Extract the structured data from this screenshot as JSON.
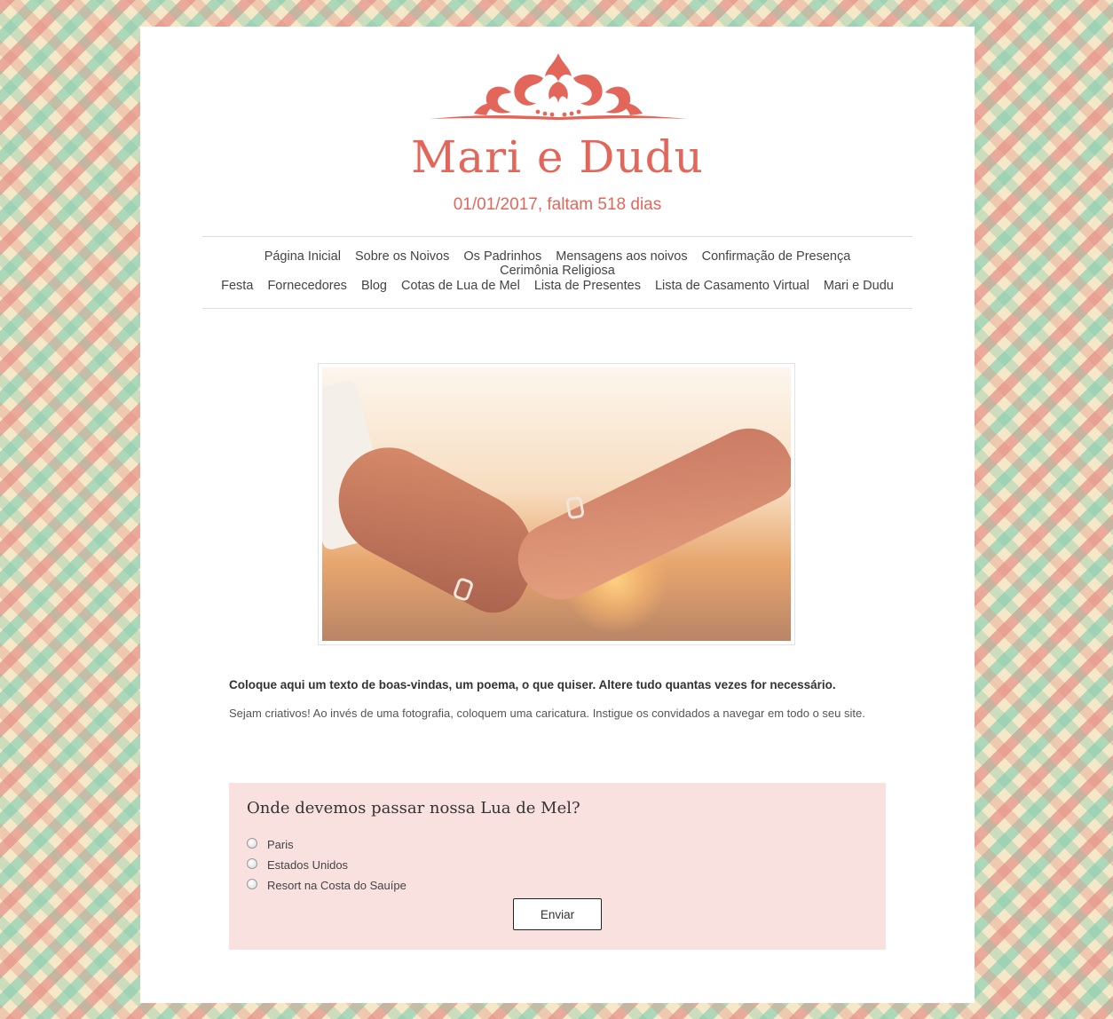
{
  "header": {
    "title": "Mari e Dudu",
    "subtitle": "01/01/2017, faltam 518 dias"
  },
  "nav": {
    "row1": [
      "Página Inicial",
      "Sobre os Noivos",
      "Os Padrinhos",
      "Mensagens aos noivos",
      "Confirmação de Presença",
      "Cerimônia Religiosa"
    ],
    "row2": [
      "Festa",
      "Fornecedores",
      "Blog",
      "Cotas de Lua de Mel",
      "Lista de Presentes",
      "Lista de Casamento Virtual",
      "Mari e Dudu"
    ]
  },
  "intro": {
    "lead": "Coloque aqui um texto de boas-vindas, um poema, o que quiser. Altere tudo quantas vezes for necessário.",
    "body": "Sejam criativos! Ao invés de uma fotografia, coloquem uma caricatura. Instigue os convidados a navegar em todo o seu site."
  },
  "poll": {
    "question": "Onde devemos passar nossa Lua de Mel?",
    "options": [
      "Paris",
      "Estados Unidos",
      "Resort na Costa do Sauípe"
    ],
    "submit_label": "Enviar"
  },
  "colors": {
    "accent": "#e2675a",
    "poll_background": "#f9e1e0",
    "pattern_pink": "#e6968c",
    "pattern_mint": "#96d2b4",
    "pattern_cream": "#f4e8c9"
  },
  "icons": {
    "ornament": "damask-flourish-icon",
    "hero": "wedding-hands-photo"
  }
}
